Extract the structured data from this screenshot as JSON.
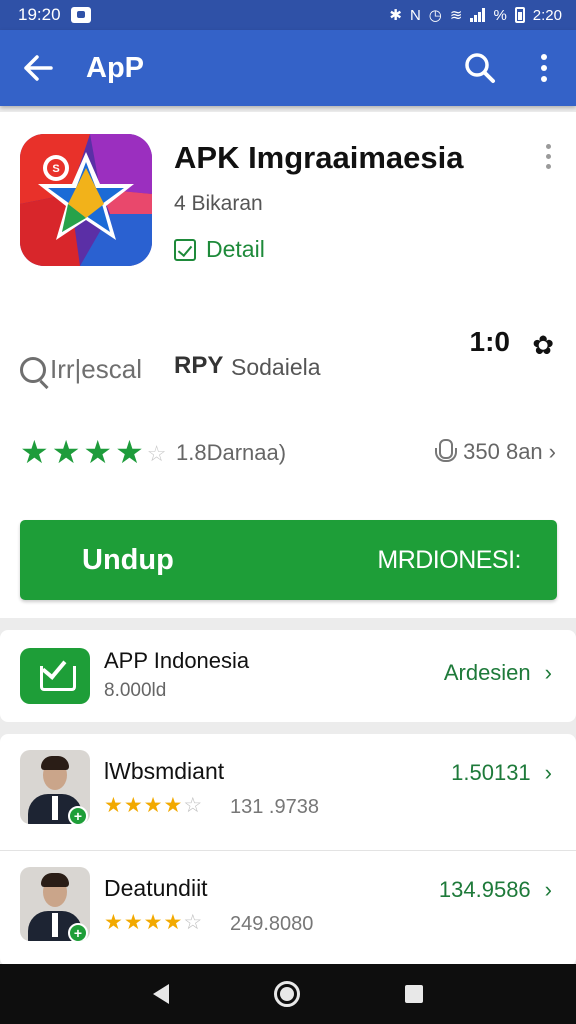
{
  "status_bar": {
    "time_left": "19:20",
    "percent_symbol": "%",
    "time_right": "2:20"
  },
  "app_bar": {
    "title": "ApP"
  },
  "app": {
    "name": "APK Imgraaimaesia",
    "subtitle": "4 Bikaran",
    "detail_link": "Detail",
    "developer_logo_text": "Irr|escal",
    "apk_label": "RPY",
    "apk_subtitle": "Sodaiela",
    "version": "1:0",
    "rating_stars": 4,
    "review_count": "1.8Darnaa)",
    "installs": "350 8an"
  },
  "install_button": {
    "left_label": "Undup",
    "right_label": "MRDIONESI:"
  },
  "related_app": {
    "title": "APP Indonesia",
    "subtitle": "8.000ld",
    "action": "Ardesien"
  },
  "reviews": [
    {
      "name": "lWbsmdiant",
      "stars": 4,
      "meta": "131 .9738",
      "score": "1.50131"
    },
    {
      "name": "Deatundiit",
      "stars": 4,
      "meta": "249.8080",
      "score": "134.9586"
    }
  ],
  "colors": {
    "status_bar": "#2f51a7",
    "app_bar": "#3462c8",
    "accent_green": "#1e9e38",
    "review_star": "#f2a900"
  },
  "icons": [
    "back-arrow-icon",
    "search-icon",
    "more-vert-icon",
    "check-box-icon",
    "gear-icon",
    "mic-icon",
    "chevron-right-icon",
    "download-icon",
    "nav-back-icon",
    "nav-home-icon",
    "nav-recents-icon"
  ]
}
